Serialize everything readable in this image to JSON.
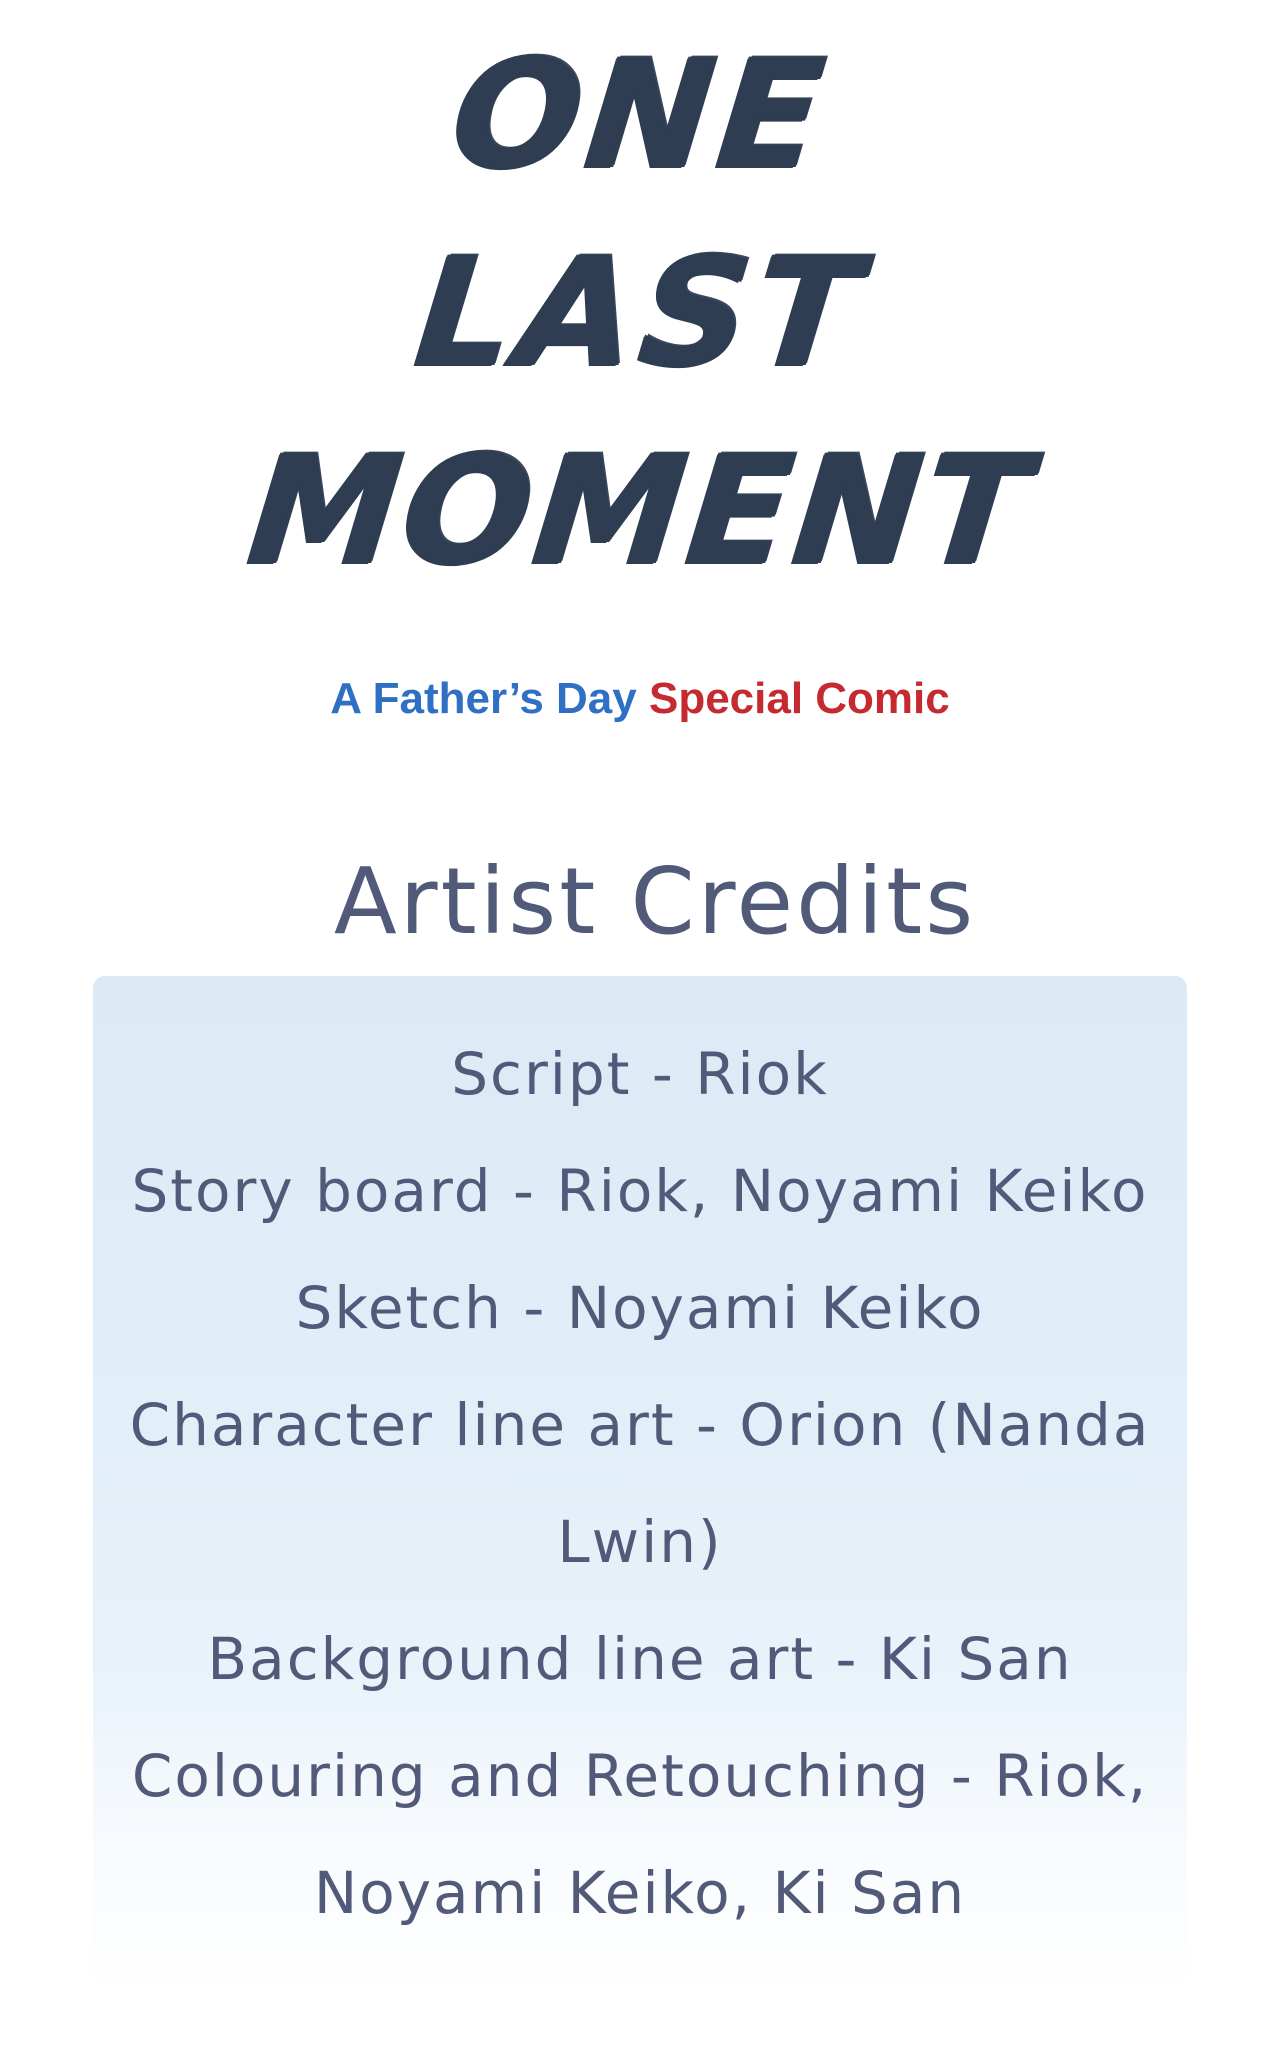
{
  "title": {
    "line1": "ONE",
    "line2": "LAST",
    "line3": "MOMENT"
  },
  "subtitle": {
    "part1": "A Father’s Day",
    "part2": "Special Comic",
    "color_part1": "#2f6fc4",
    "color_part2": "#c42a2f"
  },
  "credits": {
    "heading": "Artist Credits",
    "lines": [
      "Script - Riok",
      "Story board - Riok, Noyami Keiko",
      "Sketch - Noyami Keiko",
      "Character line art - Orion (Nanda",
      "Lwin)",
      "Background line art - Ki San",
      "Colouring and Retouching - Riok,",
      "Noyami Keiko, Ki San"
    ]
  }
}
